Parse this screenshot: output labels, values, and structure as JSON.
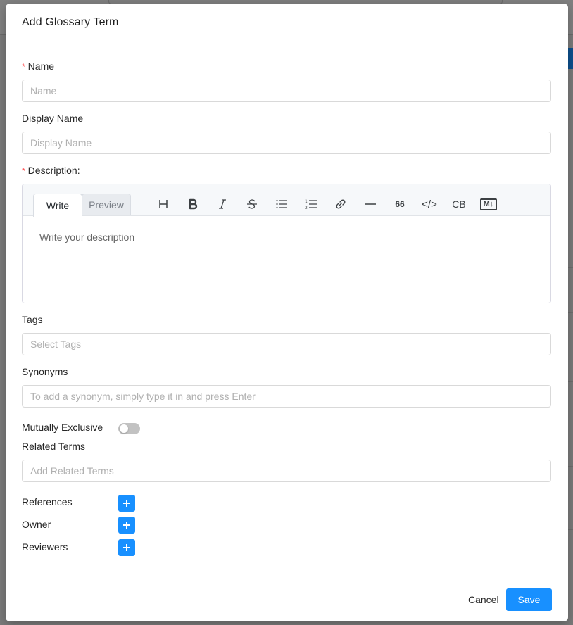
{
  "modal": {
    "title": "Add Glossary Term"
  },
  "form": {
    "required_marker": "*",
    "name": {
      "label": "Name",
      "placeholder": "Name",
      "value": ""
    },
    "display_name": {
      "label": "Display Name",
      "placeholder": "Display Name",
      "value": ""
    },
    "description": {
      "label": "Description:",
      "tabs": [
        {
          "label": "Write",
          "active": true
        },
        {
          "label": "Preview",
          "active": false
        }
      ],
      "toolbar": [
        {
          "name": "heading-icon",
          "glyph": "H"
        },
        {
          "name": "bold-icon",
          "glyph": "B"
        },
        {
          "name": "italic-icon",
          "glyph": "I"
        },
        {
          "name": "strikethrough-icon",
          "glyph": "S"
        },
        {
          "name": "unordered-list-icon",
          "glyph": ""
        },
        {
          "name": "ordered-list-icon",
          "glyph": ""
        },
        {
          "name": "link-icon",
          "glyph": ""
        },
        {
          "name": "horizontal-rule-icon",
          "glyph": ""
        },
        {
          "name": "quote-icon",
          "glyph": "66"
        },
        {
          "name": "code-icon",
          "glyph": "</>"
        },
        {
          "name": "code-block-icon",
          "glyph": "CB"
        },
        {
          "name": "markdown-icon",
          "glyph": "M↓"
        }
      ],
      "placeholder": "Write your description"
    },
    "tags": {
      "label": "Tags",
      "placeholder": "Select Tags"
    },
    "synonyms": {
      "label": "Synonyms",
      "placeholder": "To add a synonym, simply type it in and press Enter"
    },
    "mutually_exclusive": {
      "label": "Mutually Exclusive",
      "enabled": false
    },
    "related_terms": {
      "label": "Related Terms",
      "placeholder": "Add Related Terms"
    },
    "references": {
      "label": "References"
    },
    "owner": {
      "label": "Owner"
    },
    "reviewers": {
      "label": "Reviewers"
    }
  },
  "footer": {
    "cancel_label": "Cancel",
    "save_label": "Save"
  },
  "colors": {
    "primary": "#1890ff",
    "required": "#ff4d4f",
    "toggle_off": "#c2c2c2"
  }
}
